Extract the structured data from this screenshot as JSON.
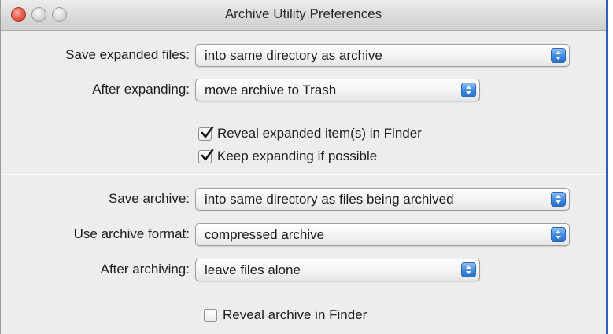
{
  "window": {
    "title": "Archive Utility Preferences"
  },
  "expand": {
    "save_expanded_label": "Save expanded files:",
    "save_expanded_value": "into same directory as archive",
    "after_expanding_label": "After expanding:",
    "after_expanding_value": "move archive to Trash",
    "reveal_expanded": {
      "label": "Reveal expanded item(s) in Finder",
      "checked": true
    },
    "keep_expanding": {
      "label": "Keep expanding if possible",
      "checked": true
    }
  },
  "archive": {
    "save_archive_label": "Save archive:",
    "save_archive_value": "into same directory as files being archived",
    "format_label": "Use archive format:",
    "format_value": "compressed archive",
    "after_archiving_label": "After archiving:",
    "after_archiving_value": "leave files alone",
    "reveal_archive": {
      "label": "Reveal archive in Finder",
      "checked": false
    }
  },
  "icons": {
    "checkmark": "checkmark-icon",
    "stepper": "up-down-arrows-icon"
  },
  "colors": {
    "window_border": "#2f5fb8",
    "stepper_blue": "#3f89df",
    "close_red": "#e9604f"
  }
}
